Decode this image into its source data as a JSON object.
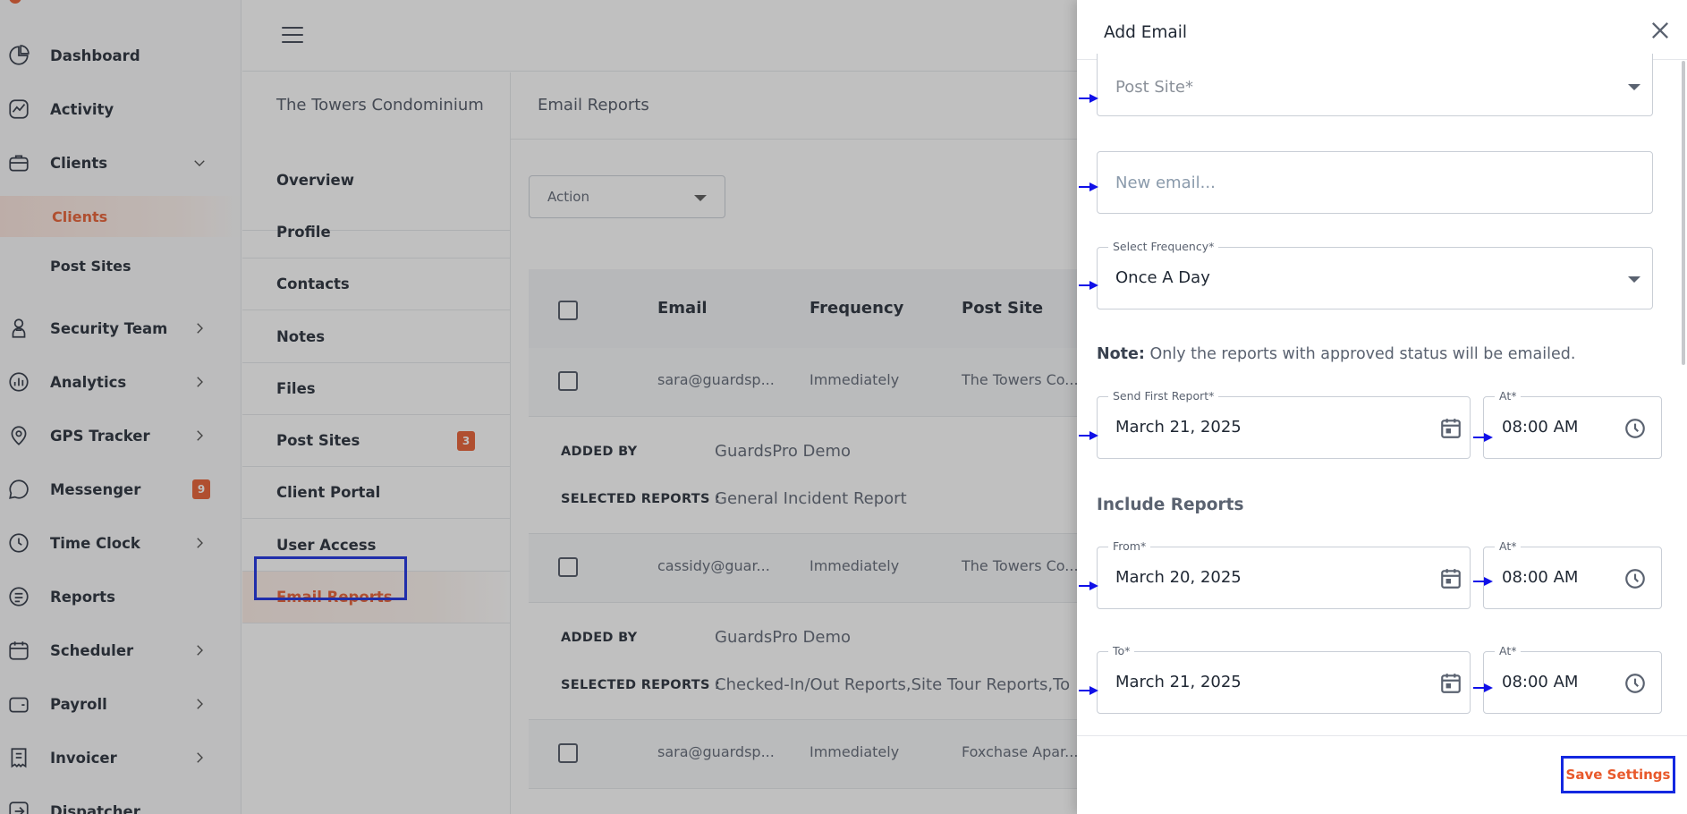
{
  "sidebar": {
    "items": [
      {
        "label": "Dashboard",
        "icon": "dashboard-icon"
      },
      {
        "label": "Activity",
        "icon": "activity-icon"
      },
      {
        "label": "Clients",
        "icon": "briefcase-icon"
      },
      {
        "label": "Security Team",
        "icon": "guard-icon"
      },
      {
        "label": "Analytics",
        "icon": "analytics-icon"
      },
      {
        "label": "GPS Tracker",
        "icon": "location-pin-icon"
      },
      {
        "label": "Messenger",
        "icon": "chat-icon",
        "badge": "9"
      },
      {
        "label": "Time Clock",
        "icon": "clock-icon"
      },
      {
        "label": "Reports",
        "icon": "report-icon"
      },
      {
        "label": "Scheduler",
        "icon": "calendar-icon"
      },
      {
        "label": "Payroll",
        "icon": "wallet-icon"
      },
      {
        "label": "Invoicer",
        "icon": "invoice-icon"
      },
      {
        "label": "Dispatcher",
        "icon": "dispatch-icon"
      }
    ],
    "clients_sub": [
      {
        "label": "Clients",
        "active": true
      },
      {
        "label": "Post Sites"
      }
    ]
  },
  "client_menu": {
    "title": "The Towers Condominium",
    "items": [
      {
        "label": "Overview"
      },
      {
        "label": "Profile"
      },
      {
        "label": "Contacts"
      },
      {
        "label": "Notes"
      },
      {
        "label": "Files"
      },
      {
        "label": "Post Sites",
        "badge": "3"
      },
      {
        "label": "Client Portal"
      },
      {
        "label": "User Access"
      },
      {
        "label": "Email Reports",
        "active": true
      }
    ]
  },
  "content": {
    "title": "Email Reports",
    "action_label": "Action",
    "columns": [
      "Email",
      "Frequency",
      "Post Site"
    ],
    "rows": [
      {
        "email": "sara@guardsp...",
        "frequency": "Immediately",
        "post_site": "The Towers Co...",
        "added_by_label": "ADDED BY",
        "added_by": "GuardsPro Demo",
        "reports_label": "SELECTED REPORTS :",
        "reports": "General Incident Report"
      },
      {
        "email": "cassidy@guar...",
        "frequency": "Immediately",
        "post_site": "The Towers Co...",
        "added_by_label": "ADDED BY",
        "added_by": "GuardsPro Demo",
        "reports_label": "SELECTED REPORTS :",
        "reports": "Checked-In/Out Reports,Site Tour Reports,To"
      },
      {
        "email": "sara@guardsp...",
        "frequency": "Immediately",
        "post_site": "Foxchase Apar..."
      }
    ]
  },
  "drawer": {
    "title": "Add Email",
    "post_site_placeholder": "Post Site*",
    "email_placeholder": "New email...",
    "frequency": {
      "label": "Select Frequency*",
      "value": "Once A Day"
    },
    "note_bold": "Note:",
    "note_text": " Only the reports with approved status will be emailed.",
    "send_first": {
      "label": "Send First Report*",
      "date": "March 21, 2025",
      "at_label": "At*",
      "time": "08:00 AM"
    },
    "include_title": "Include Reports",
    "from": {
      "label": "From*",
      "date": "March 20, 2025",
      "at_label": "At*",
      "time": "08:00 AM"
    },
    "to": {
      "label": "To*",
      "date": "March 21, 2025",
      "at_label": "At*",
      "time": "08:00 AM"
    },
    "save_label": "Save Settings"
  },
  "colors": {
    "accent": "#e8592b",
    "highlight": "#1428e0",
    "annotation_arrow": "#1010e8"
  }
}
